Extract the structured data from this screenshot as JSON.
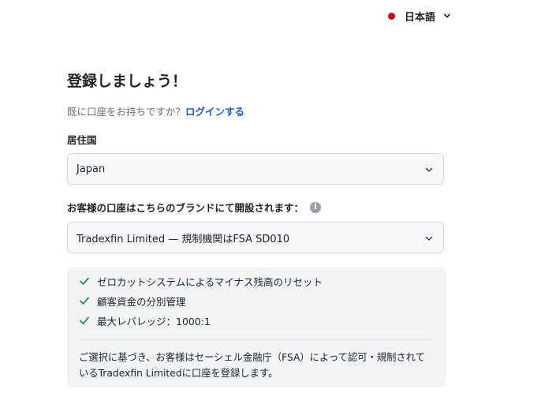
{
  "language": {
    "label": "日本語",
    "flag_color": "#c40c1c",
    "flag_icon": "red-dot-icon",
    "chevron_icon": "chevron-down-icon"
  },
  "form": {
    "title": "登録しましょう！",
    "login_prompt": "既に口座をお持ちですか？",
    "login_link": "ログインする",
    "country_label": "居住国",
    "country_value": "Japan",
    "brand_label": "お客様の口座はこちらのブランドにて開設されます：",
    "brand_info_icon": "i",
    "brand_value": "Tradexfin Limited — 規制機関はFSA SD010"
  },
  "features": {
    "items": [
      "ゼロカットシステムによるマイナス残高のリセット",
      "顧客資金の分別管理",
      "最大レバレッジ：1000:1"
    ],
    "check_color": "#2e8b57"
  },
  "note": {
    "text": "ご選択に基づき、お客様はセーシェル金融庁（FSA）によって認可・規制されているTradexfin Limitedに口座を登録します。"
  }
}
